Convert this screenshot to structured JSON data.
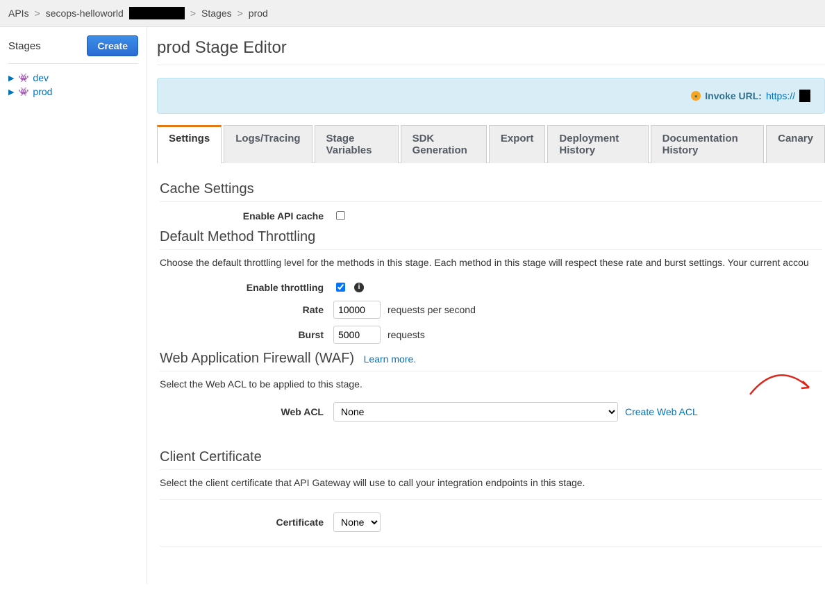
{
  "breadcrumb": {
    "items": [
      "APIs",
      "secops-helloworld",
      "",
      "Stages",
      "prod"
    ]
  },
  "sidebar": {
    "title": "Stages",
    "create_label": "Create",
    "items": [
      {
        "label": "dev"
      },
      {
        "label": "prod"
      }
    ]
  },
  "page": {
    "title": "prod Stage Editor"
  },
  "alert": {
    "label": "Invoke URL:",
    "url_prefix": "https://"
  },
  "tabs": [
    {
      "label": "Settings",
      "active": true
    },
    {
      "label": "Logs/Tracing"
    },
    {
      "label": "Stage Variables"
    },
    {
      "label": "SDK Generation"
    },
    {
      "label": "Export"
    },
    {
      "label": "Deployment History"
    },
    {
      "label": "Documentation History"
    },
    {
      "label": "Canary"
    }
  ],
  "cache": {
    "title": "Cache Settings",
    "enable_label": "Enable API cache"
  },
  "throttling": {
    "title": "Default Method Throttling",
    "desc": "Choose the default throttling level for the methods in this stage. Each method in this stage will respect these rate and burst settings. Your current accou",
    "enable_label": "Enable throttling",
    "rate_label": "Rate",
    "rate_value": "10000",
    "rate_suffix": "requests per second",
    "burst_label": "Burst",
    "burst_value": "5000",
    "burst_suffix": "requests"
  },
  "waf": {
    "title": "Web Application Firewall (WAF)",
    "learn_more": "Learn more.",
    "desc": "Select the Web ACL to be applied to this stage.",
    "acl_label": "Web ACL",
    "acl_value": "None",
    "create_link": "Create Web ACL"
  },
  "cert": {
    "title": "Client Certificate",
    "desc": "Select the client certificate that API Gateway will use to call your integration endpoints in this stage.",
    "label": "Certificate",
    "value": "None"
  }
}
